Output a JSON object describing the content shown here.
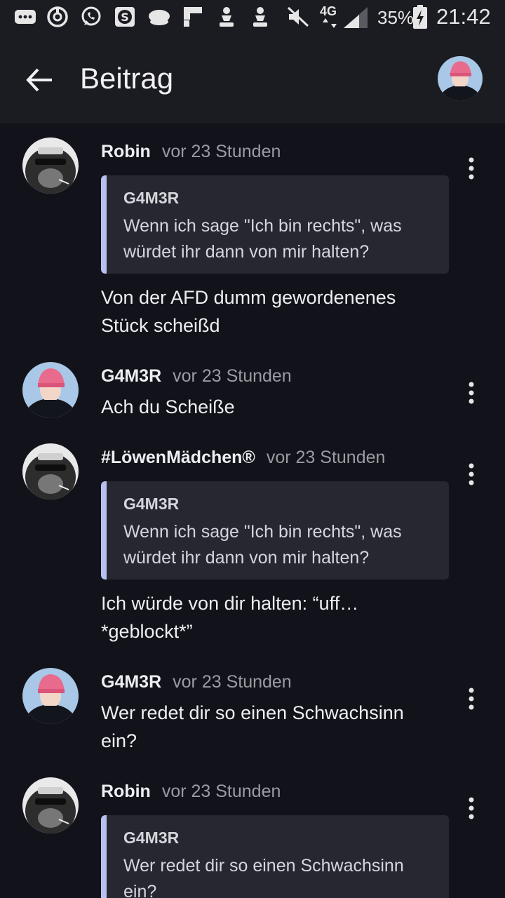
{
  "status_bar": {
    "network": "4G",
    "battery": "35%",
    "time": "21:42"
  },
  "app_bar": {
    "title": "Beitrag"
  },
  "posts": [
    {
      "author": "Robin",
      "time": "vor 23 Stunden",
      "avatar": "gorilla",
      "quote": {
        "author": "G4M3R",
        "text": "Wenn ich sage \"Ich bin rechts\", was würdet ihr dann von mir halten?"
      },
      "text": "Von der AFD dumm gewordenenes Stück scheißd"
    },
    {
      "author": "G4M3R",
      "time": "vor 23 Stunden",
      "avatar": "pink-hat",
      "quote": null,
      "text": "Ach du Scheiße"
    },
    {
      "author": "#LöwenMädchen®",
      "time": "vor 23 Stunden",
      "avatar": "gorilla",
      "quote": {
        "author": "G4M3R",
        "text": "Wenn ich sage \"Ich bin rechts\", was würdet ihr dann von mir halten?"
      },
      "text": "Ich würde von dir halten: “uff… *geblockt*”"
    },
    {
      "author": "G4M3R",
      "time": "vor 23 Stunden",
      "avatar": "pink-hat",
      "quote": null,
      "text": "Wer redet dir so einen Schwachsinn ein?"
    },
    {
      "author": "Robin",
      "time": "vor 23 Stunden",
      "avatar": "gorilla",
      "quote": {
        "author": "G4M3R",
        "text": "Wer redet dir so einen Schwachsinn ein?"
      },
      "text": ""
    }
  ],
  "colors": {
    "background": "#12131a",
    "bar": "#1b1c22",
    "quote_bg": "#262730",
    "quote_accent": "#b8c0f2",
    "muted_text": "#9a9ba3"
  }
}
